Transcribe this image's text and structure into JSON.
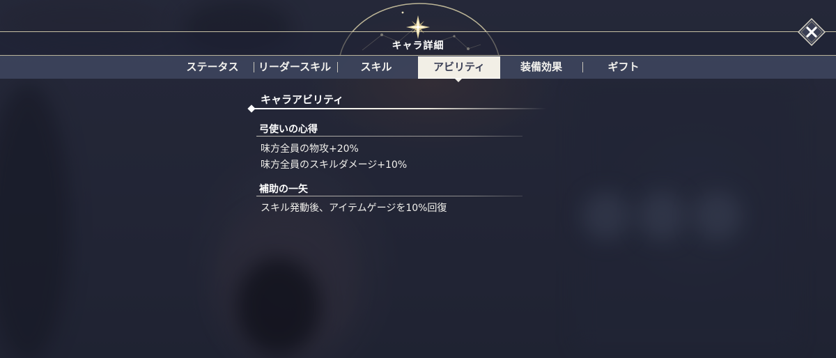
{
  "header": {
    "title": "キャラ詳細"
  },
  "tabs": [
    {
      "label": "ステータス",
      "active": false
    },
    {
      "label": "リーダースキル",
      "active": false
    },
    {
      "label": "スキル",
      "active": false
    },
    {
      "label": "アビリティ",
      "active": true
    },
    {
      "label": "装備効果",
      "active": false
    },
    {
      "label": "ギフト",
      "active": false
    }
  ],
  "section": {
    "title": "キャラアビリティ"
  },
  "abilities": [
    {
      "name": "弓使いの心得",
      "lines": [
        "味方全員の物攻+20%",
        "味方全員のスキルダメージ+10%"
      ]
    },
    {
      "name": "補助の一矢",
      "lines": [
        "スキル発動後、アイテムゲージを10%回復"
      ]
    }
  ],
  "icons": {
    "close": "close-icon",
    "emblem": "compass-star-icon"
  },
  "colors": {
    "accent": "#c8c1a4",
    "active_tab_bg": "#f2efe6",
    "active_tab_text": "#3a3f55"
  }
}
